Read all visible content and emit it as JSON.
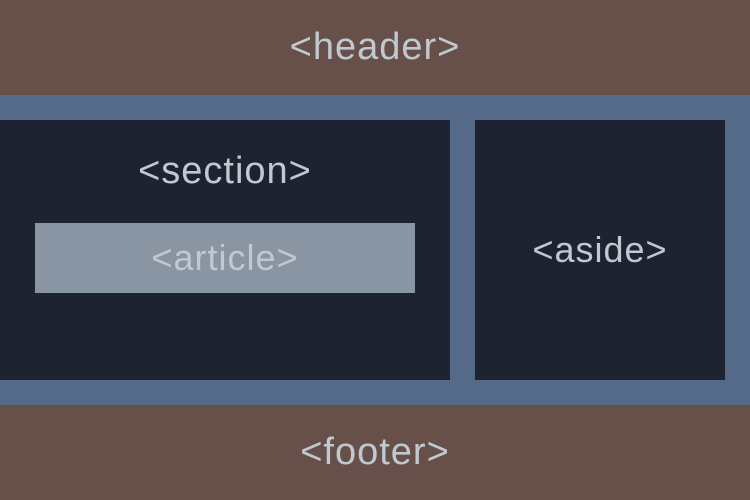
{
  "layout": {
    "header": "<header>",
    "section": "<section>",
    "article": "<article>",
    "aside": "<aside>",
    "footer": "<footer>"
  }
}
